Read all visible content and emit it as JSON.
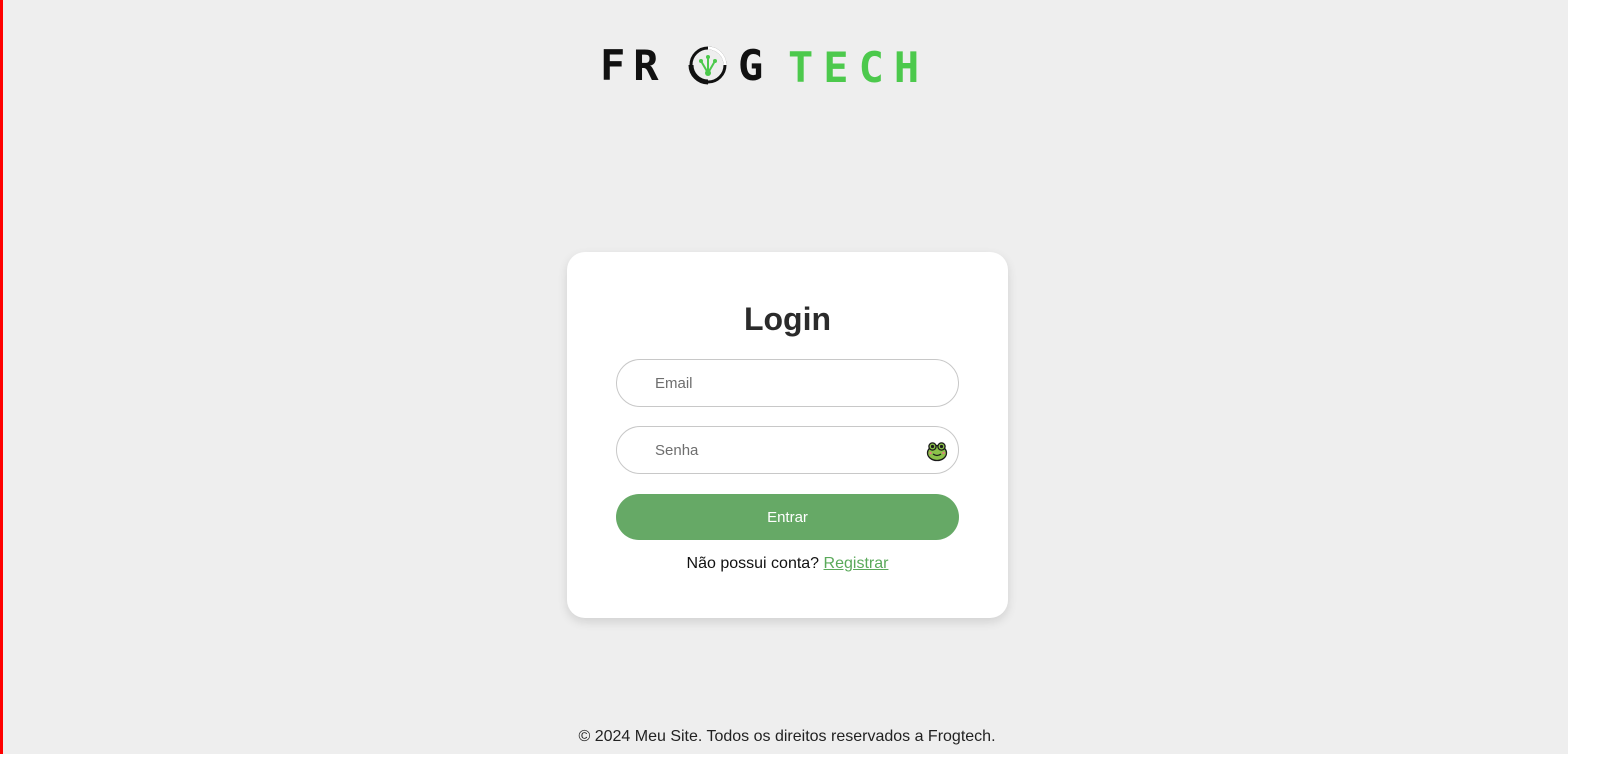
{
  "brand": {
    "logo_part1": "FR",
    "logo_part2": "G",
    "logo_part3": "TECH",
    "colors": {
      "dark": "#111111",
      "green": "#4cc94c"
    }
  },
  "login_card": {
    "title": "Login",
    "email_placeholder": "Email",
    "password_placeholder": "Senha",
    "password_toggle_icon": "frog-icon",
    "submit_label": "Entrar",
    "no_account_text": "Não possui conta?",
    "register_link": "Registrar"
  },
  "footer": {
    "text": "© 2024 Meu Site. Todos os direitos reservados a Frogtech."
  },
  "theme": {
    "accent": "#66a966",
    "link": "#5aa95a",
    "background": "#eeeeee"
  }
}
